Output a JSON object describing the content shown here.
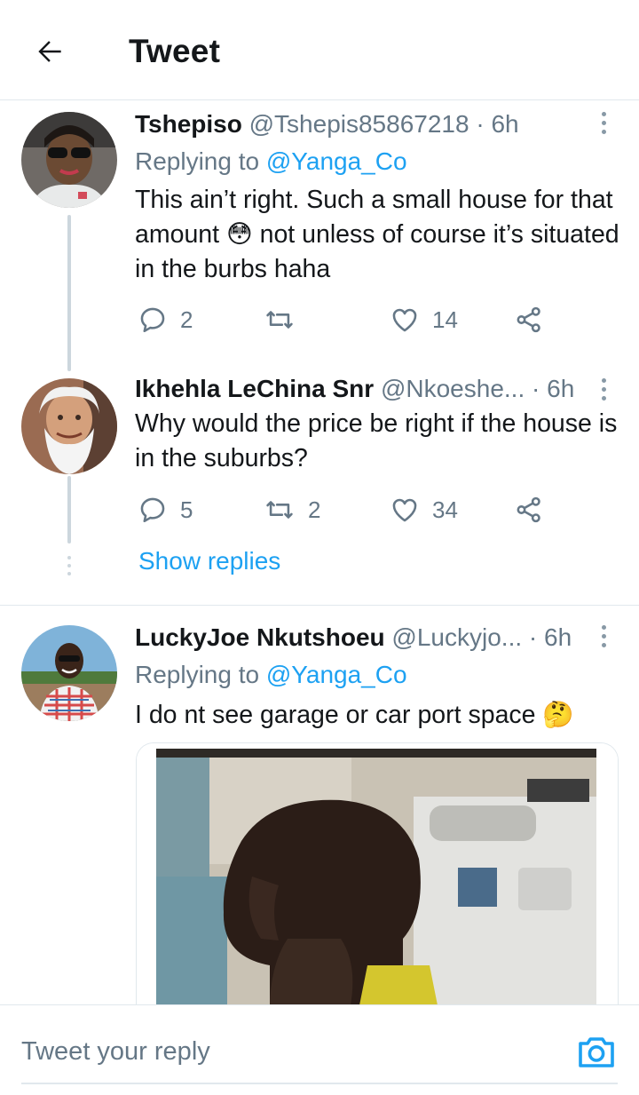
{
  "header": {
    "title": "Tweet"
  },
  "tweets": [
    {
      "name": "Tshepiso",
      "handle": "@Tshepis85867218",
      "time": "· 6h",
      "replying_prefix": "Replying to",
      "replying_handle": "@Yanga_Co",
      "body": "This ain’t right. Such a small house for that amount 😳 not unless of course it’s situated in the burbs haha",
      "replies": "2",
      "retweets": "",
      "likes": "14"
    },
    {
      "name": "Ikhehla LeChina Snr",
      "handle": "@Nkoeshe...",
      "time": "· 6h",
      "body": "Why would the price be right if the house is in the suburbs?",
      "replies": "5",
      "retweets": "2",
      "likes": "34"
    },
    {
      "name": "LuckyJoe  Nkutshoeu",
      "handle": "@Luckyjo...",
      "time": "· 6h",
      "replying_prefix": "Replying to",
      "replying_handle": "@Yanga_Co",
      "body": "I do nt see garage or car port space 🤔"
    }
  ],
  "thread": {
    "show_replies": "Show replies"
  },
  "composer": {
    "placeholder": "Tweet your reply"
  },
  "icons": {
    "back": "back-arrow-icon",
    "more": "more-vertical-icon",
    "reply": "reply-icon",
    "retweet": "retweet-icon",
    "like": "heart-icon",
    "share": "share-icon",
    "camera": "camera-icon"
  },
  "colors": {
    "accent": "#1da1f2",
    "secondary_text": "#657786",
    "divider": "#e1e8ed"
  }
}
